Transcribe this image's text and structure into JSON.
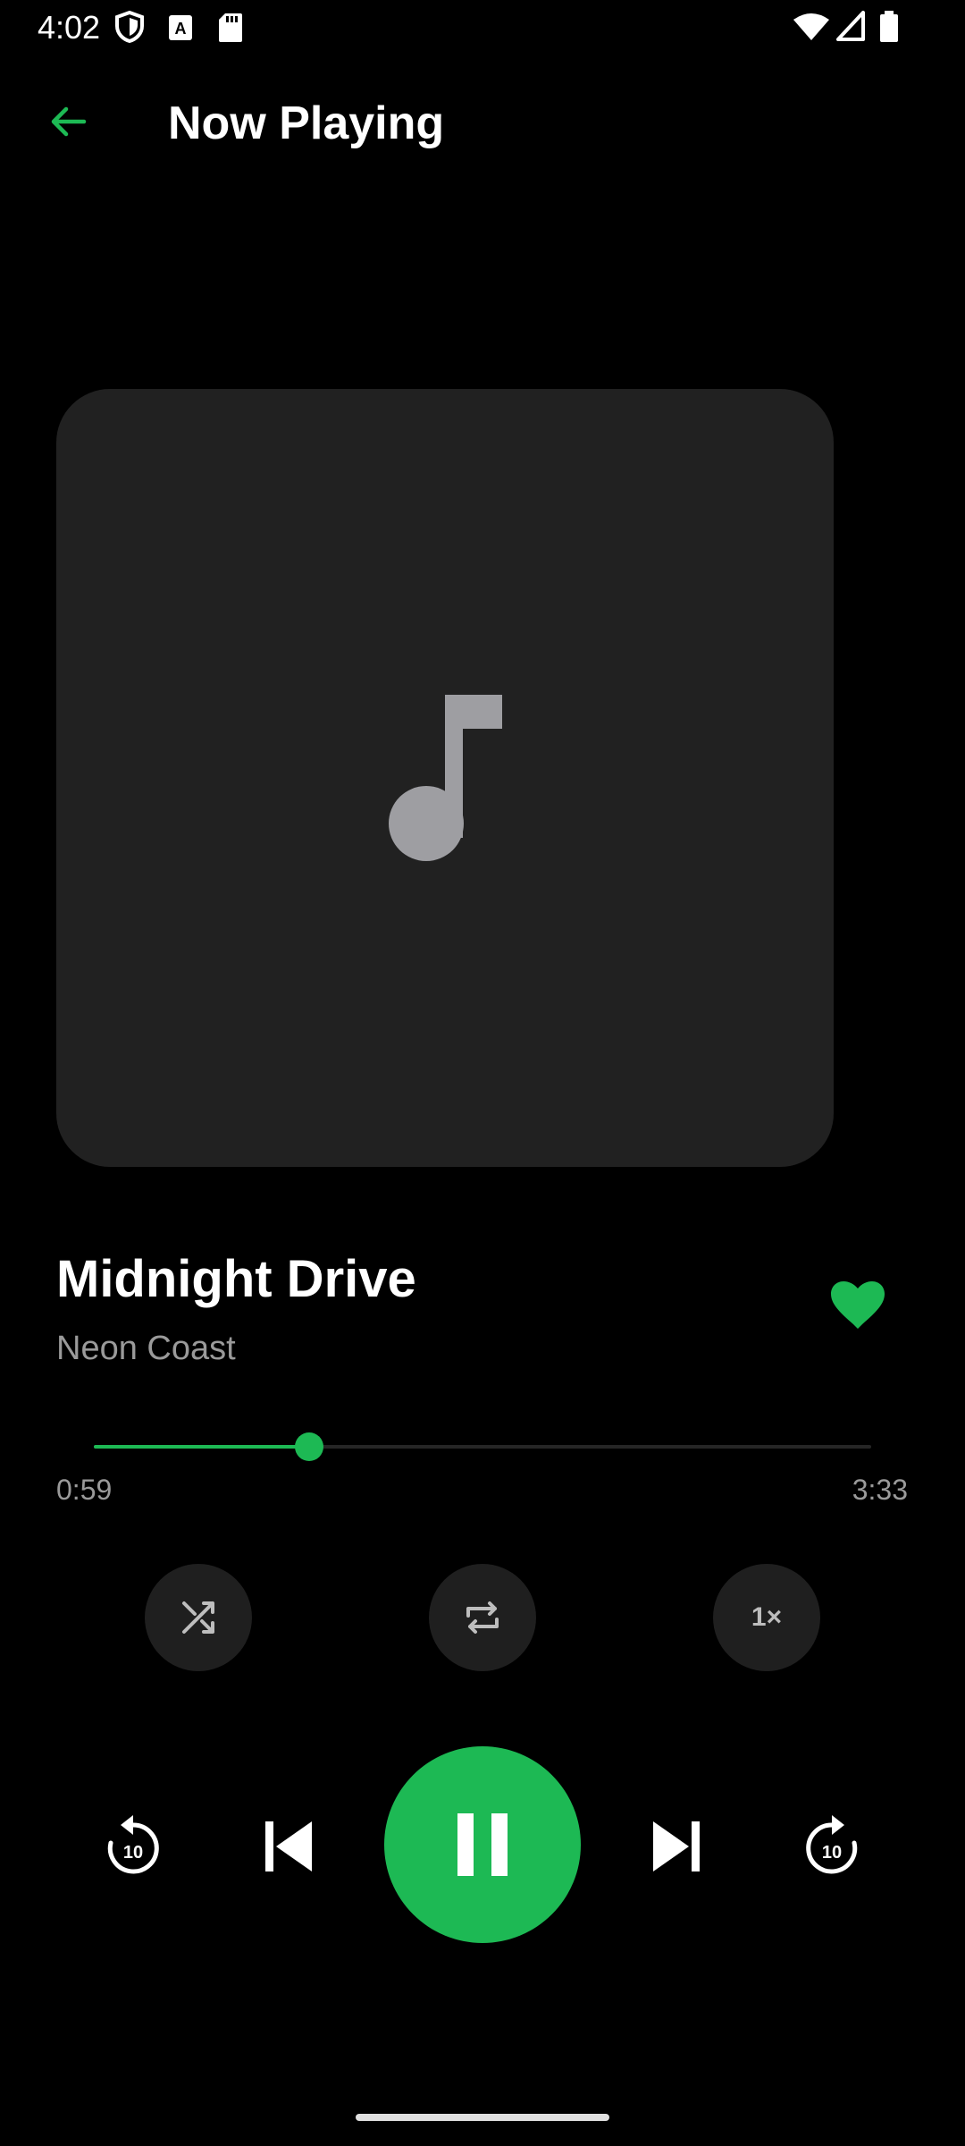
{
  "status_bar": {
    "time": "4:02",
    "icons": [
      "shield-icon",
      "font-a-icon",
      "sd-card-icon",
      "wifi-icon",
      "signal-icon",
      "battery-icon"
    ]
  },
  "header": {
    "title": "Now Playing",
    "back_icon": "arrow-left-icon"
  },
  "artwork": {
    "icon": "music-note-icon"
  },
  "track": {
    "title": "Midnight Drive",
    "artist": "Neon Coast",
    "liked": true
  },
  "progress": {
    "elapsed": "0:59",
    "total": "3:33",
    "fraction": 0.277
  },
  "secondary_controls": {
    "shuffle_icon": "shuffle-icon",
    "repeat_icon": "repeat-icon",
    "speed_label": "1×"
  },
  "transport": {
    "rewind_label": "10",
    "forward_label": "10",
    "playing": true
  },
  "colors": {
    "accent": "#1db954",
    "background": "#000000",
    "surface": "#212121",
    "secondary_text": "#9a9a9a"
  }
}
